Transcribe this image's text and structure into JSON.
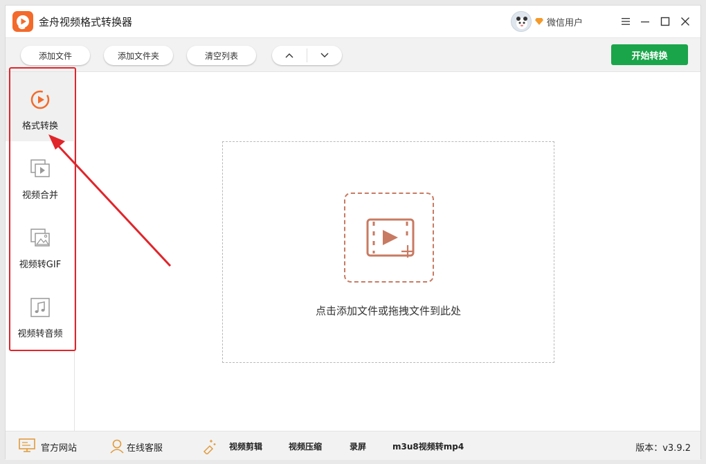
{
  "window": {
    "title": "金舟视频格式转换器",
    "user_name": "微信用户"
  },
  "toolbar": {
    "add_file": "添加文件",
    "add_folder": "添加文件夹",
    "clear_list": "清空列表",
    "start": "开始转换"
  },
  "sidebar": {
    "items": [
      {
        "label": "格式转换",
        "icon": "format-convert-icon",
        "active": true
      },
      {
        "label": "视频合并",
        "icon": "video-merge-icon",
        "active": false
      },
      {
        "label": "视频转GIF",
        "icon": "video-to-gif-icon",
        "active": false
      },
      {
        "label": "视频转音频",
        "icon": "video-to-audio-icon",
        "active": false
      }
    ]
  },
  "main": {
    "drop_hint": "点击添加文件或拖拽文件到此处"
  },
  "footer": {
    "website": "官方网站",
    "support": "在线客服",
    "links": [
      "视频剪辑",
      "视频压缩",
      "录屏",
      "m3u8视频转mp4"
    ],
    "version": "版本：v3.9.2"
  },
  "colors": {
    "accent": "#f36a2b",
    "start_button": "#1aa54a",
    "annotation": "#e0252b",
    "drop_icon": "#c87a62"
  }
}
